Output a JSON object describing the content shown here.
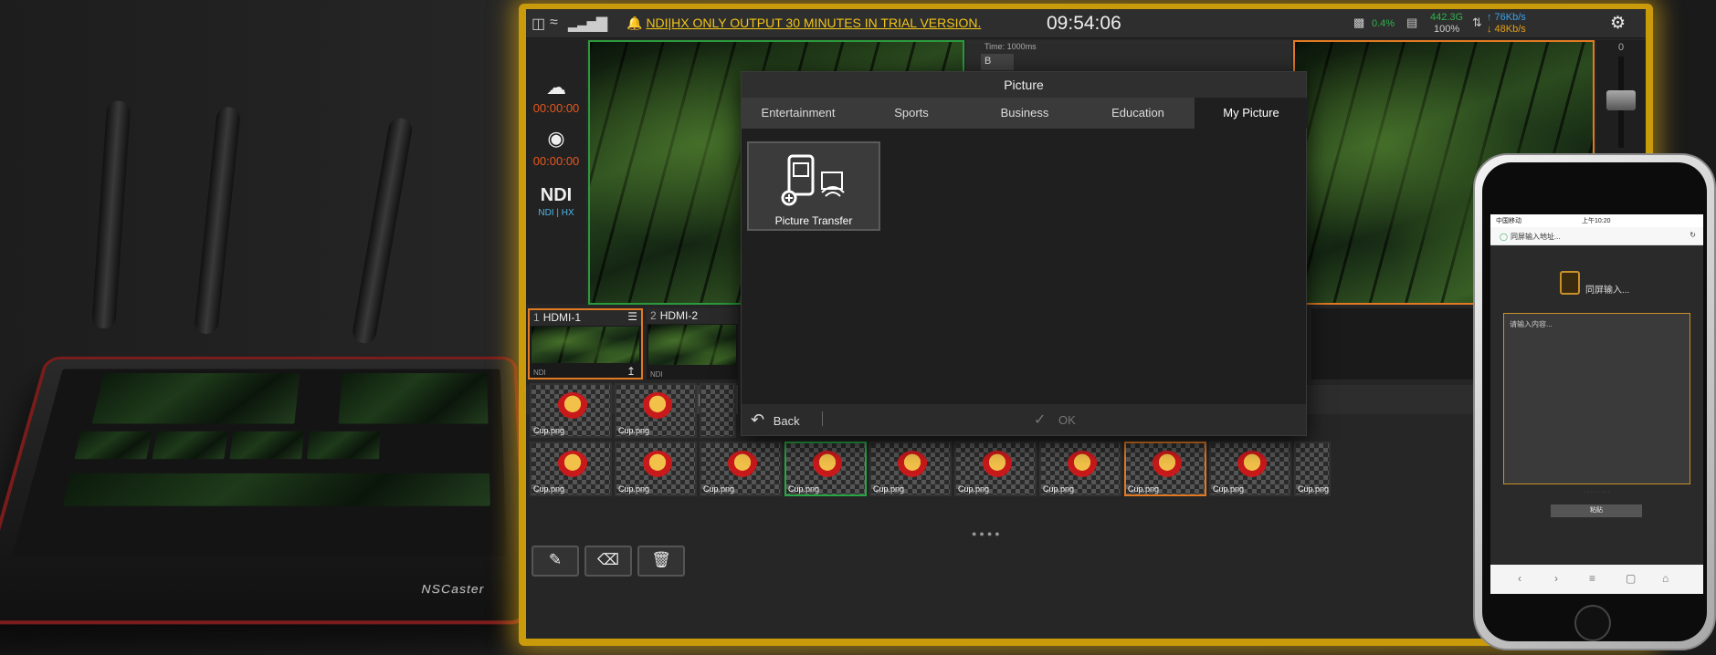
{
  "topbar": {
    "warning": "NDI|HX ONLY OUTPUT 30 MINUTES IN TRIAL VERSION.",
    "clock": "09:54:06",
    "cpu": "0.4%",
    "storage": "442.3G",
    "storage_pct": "100%",
    "upload": "↑ 76Kb/s",
    "download": "↓ 48Kb/s"
  },
  "left_column": {
    "stream_time": "00:00:00",
    "record_time": "00:00:00",
    "ndi_logo": "NDI",
    "ndi_label": "NDI | HX"
  },
  "mid_panel": {
    "time_label": "Time: 1000ms",
    "box_value": "B"
  },
  "right_bar": {
    "level_label": "0"
  },
  "sources": [
    {
      "num": "1",
      "name": "HDMI-1",
      "footer": "NDI"
    },
    {
      "num": "2",
      "name": "HDMI-2",
      "footer": "NDI"
    }
  ],
  "thumbnails": {
    "file_name": "Cup.png",
    "row1_count": 9,
    "row2_count": 9
  },
  "dialog": {
    "title": "Picture",
    "tabs": [
      "Entertainment",
      "Sports",
      "Business",
      "Education",
      "My Picture"
    ],
    "active_tab": "My Picture",
    "tile_label": "Picture Transfer",
    "back_label": "Back",
    "ok_label": "OK"
  },
  "phone": {
    "carrier": "中国移动",
    "time": "上午10:20",
    "url": "同屏输入地址...",
    "app_title": "同屏输入...",
    "placeholder": "请输入内容...",
    "paste_label": "粘贴"
  },
  "device": {
    "brand": "NSCaster"
  },
  "colors": {
    "accent": "#e2a01a",
    "program_border": "#e27a22",
    "preview_border": "#2c9a3c",
    "frame_glow": "#c99a0a",
    "warning_text": "#f2c618"
  }
}
